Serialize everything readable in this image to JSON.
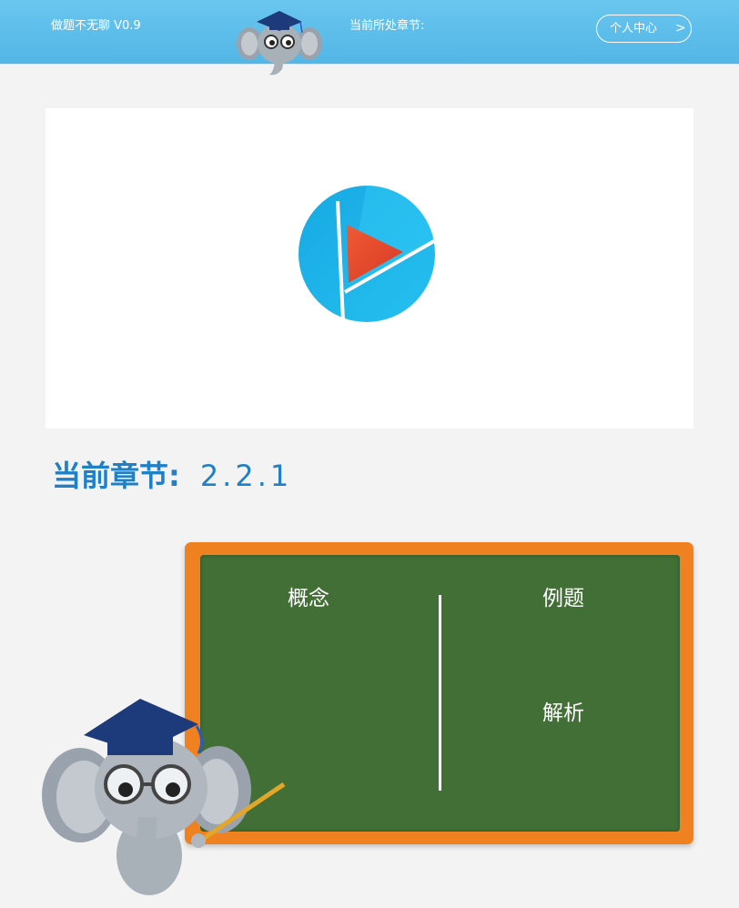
{
  "header": {
    "app_title": "做题不无聊 V0.9",
    "chapter_label": "当前所处章节:",
    "user_center_label": "个人中心",
    "user_center_chevron": ">"
  },
  "video": {
    "play_icon": "play-icon"
  },
  "chapter": {
    "label": "当前章节:",
    "number": "2.2.1"
  },
  "board": {
    "concept": "概念",
    "examples": "例题",
    "analysis": "解析"
  },
  "colors": {
    "header_blue": "#5bbcea",
    "chapter_text": "#1f7fc7",
    "board_green": "#426f36",
    "board_frame": "#ef8121",
    "play_blue": "#1fb6ec",
    "play_red": "#e4482d"
  }
}
